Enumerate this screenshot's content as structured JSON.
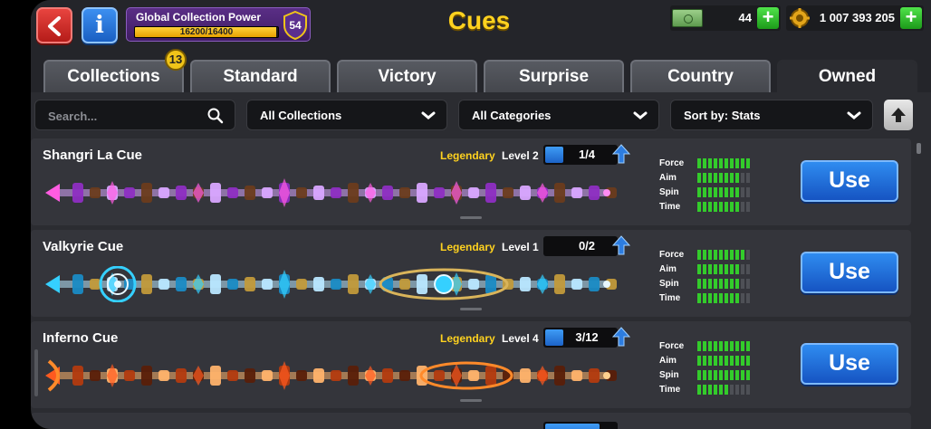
{
  "header": {
    "back_icon": "chevron-left-icon",
    "info_label": "i",
    "power_title": "Global Collection Power",
    "power_progress": "16200/16400",
    "power_fraction": 0.988,
    "power_level": "54",
    "title": "Cues",
    "cash_value": "44",
    "coins_value": "1 007 393 205",
    "plus_label": "+"
  },
  "tabs": [
    {
      "label": "Collections",
      "badge": "13"
    },
    {
      "label": "Standard"
    },
    {
      "label": "Victory"
    },
    {
      "label": "Surprise"
    },
    {
      "label": "Country"
    },
    {
      "label": "Owned",
      "active": true
    }
  ],
  "filters": {
    "search_placeholder": "Search...",
    "collection": "All Collections",
    "category": "All Categories",
    "sort": "Sort by: Stats"
  },
  "stat_labels": [
    "Force",
    "Aim",
    "Spin",
    "Time"
  ],
  "cues": [
    {
      "name": "Shangri La Cue",
      "rarity": "Legendary",
      "level": "Level 2",
      "progress": "1/4",
      "fill": 0.25,
      "stats": {
        "force": 10,
        "aim": 8,
        "spin": 8,
        "time": 8
      },
      "button": "Use",
      "theme": "pink"
    },
    {
      "name": "Valkyrie Cue",
      "rarity": "Legendary",
      "level": "Level 1",
      "progress": "0/2",
      "fill": 0,
      "stats": {
        "force": 9,
        "aim": 8,
        "spin": 8,
        "time": 8
      },
      "button": "Use",
      "theme": "blue"
    },
    {
      "name": "Inferno Cue",
      "rarity": "Legendary",
      "level": "Level 4",
      "progress": "3/12",
      "fill": 0.25,
      "stats": {
        "force": 10,
        "aim": 10,
        "spin": 10,
        "time": 6
      },
      "button": "Use",
      "theme": "orange"
    }
  ],
  "colors": {
    "accent": "#ffd21f",
    "use_button": "#1f6fd8",
    "stat_on": "#33cc2b"
  }
}
